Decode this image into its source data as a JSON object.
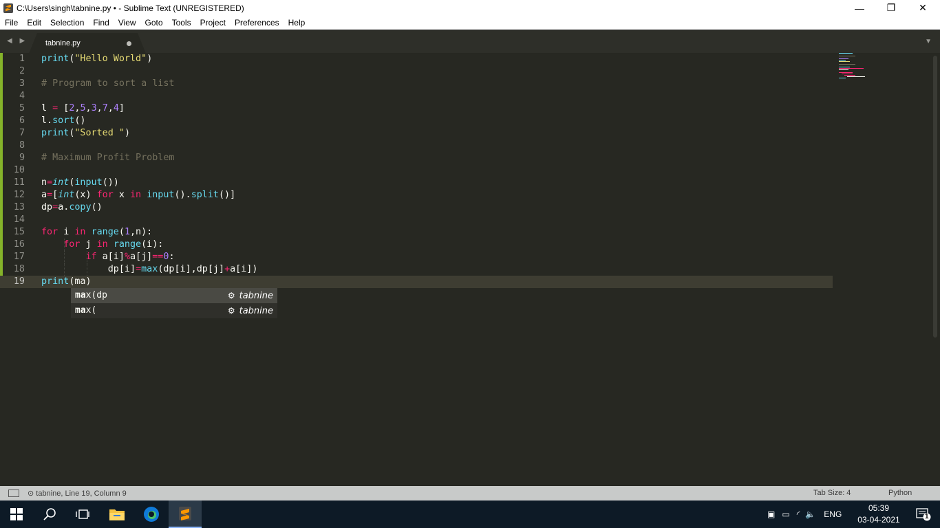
{
  "window": {
    "title": "C:\\Users\\singh\\tabnine.py • - Sublime Text (UNREGISTERED)",
    "minimize": "—",
    "restore": "❐",
    "close": "✕"
  },
  "menu": [
    "File",
    "Edit",
    "Selection",
    "Find",
    "View",
    "Goto",
    "Tools",
    "Project",
    "Preferences",
    "Help"
  ],
  "tab": {
    "label": "tabnine.py",
    "dirty": true,
    "arrows": "◀ ▶",
    "dropdown": "▼"
  },
  "editor": {
    "current_line": 19,
    "lines": [
      [
        [
          "f",
          "print"
        ],
        [
          "",
          "("
        ],
        [
          "s",
          "\"Hello World\""
        ],
        [
          "",
          ")"
        ]
      ],
      [],
      [
        [
          "c",
          "# Program to sort a list"
        ]
      ],
      [],
      [
        [
          "",
          "l "
        ],
        [
          "k",
          "="
        ],
        [
          "",
          " ["
        ],
        [
          "n",
          "2"
        ],
        [
          "",
          ","
        ],
        [
          "n",
          "5"
        ],
        [
          "",
          ","
        ],
        [
          "n",
          "3"
        ],
        [
          "",
          ","
        ],
        [
          "n",
          "7"
        ],
        [
          "",
          ","
        ],
        [
          "n",
          "4"
        ],
        [
          "",
          "]"
        ]
      ],
      [
        [
          "",
          "l."
        ],
        [
          "f",
          "sort"
        ],
        [
          "",
          "()"
        ]
      ],
      [
        [
          "f",
          "print"
        ],
        [
          "",
          "("
        ],
        [
          "s",
          "\"Sorted \""
        ],
        [
          "",
          ")"
        ]
      ],
      [],
      [
        [
          "c",
          "# Maximum Profit Problem"
        ]
      ],
      [],
      [
        [
          "",
          "n"
        ],
        [
          "k",
          "="
        ],
        [
          "t",
          "int"
        ],
        [
          "",
          "("
        ],
        [
          "f",
          "input"
        ],
        [
          "",
          "())"
        ]
      ],
      [
        [
          "",
          "a"
        ],
        [
          "k",
          "="
        ],
        [
          "",
          "["
        ],
        [
          "t",
          "int"
        ],
        [
          "",
          "(x) "
        ],
        [
          "k",
          "for"
        ],
        [
          "",
          " x "
        ],
        [
          "k",
          "in"
        ],
        [
          "",
          " "
        ],
        [
          "f",
          "input"
        ],
        [
          "",
          "()."
        ],
        [
          "f",
          "split"
        ],
        [
          "",
          "()]"
        ]
      ],
      [
        [
          "",
          "dp"
        ],
        [
          "k",
          "="
        ],
        [
          "",
          "a."
        ],
        [
          "f",
          "copy"
        ],
        [
          "",
          "()"
        ]
      ],
      [],
      [
        [
          "k",
          "for"
        ],
        [
          "",
          " i "
        ],
        [
          "k",
          "in"
        ],
        [
          "",
          " "
        ],
        [
          "f",
          "range"
        ],
        [
          "",
          "("
        ],
        [
          "n",
          "1"
        ],
        [
          "",
          ",n):"
        ]
      ],
      [
        [
          "",
          "    "
        ],
        [
          "k",
          "for"
        ],
        [
          "",
          " j "
        ],
        [
          "k",
          "in"
        ],
        [
          "",
          " "
        ],
        [
          "f",
          "range"
        ],
        [
          "",
          "(i):"
        ]
      ],
      [
        [
          "",
          "        "
        ],
        [
          "k",
          "if"
        ],
        [
          "",
          " a[i]"
        ],
        [
          "k",
          "%"
        ],
        [
          "",
          "a[j]"
        ],
        [
          "k",
          "=="
        ],
        [
          "n",
          "0"
        ],
        [
          "",
          ":"
        ]
      ],
      [
        [
          "",
          "            dp[i]"
        ],
        [
          "k",
          "="
        ],
        [
          "f",
          "max"
        ],
        [
          "",
          "(dp[i],dp[j]"
        ],
        [
          "k",
          "+"
        ],
        [
          "",
          "a[i])"
        ]
      ],
      [
        [
          "f",
          "print"
        ],
        [
          "",
          "(ma)"
        ]
      ]
    ]
  },
  "autocomplete": {
    "items": [
      {
        "match": "ma",
        "rest": "x(dp",
        "source": "tabnine",
        "icon": "tabnine-icon"
      },
      {
        "match": "ma",
        "rest": "x(",
        "source": "tabnine",
        "icon": "tabnine-icon"
      }
    ]
  },
  "status": {
    "left": "tabnine, Line 19, Column 9",
    "left_icon": "⊙",
    "tab_size": "Tab Size: 4",
    "syntax": "Python"
  },
  "taskbar": {
    "language": "ENG",
    "time": "05:39",
    "date": "03-04-2021",
    "notifications": "1"
  },
  "colors": {
    "background": "#272822",
    "keyword": "#f92672",
    "string": "#e6db74",
    "number": "#ae81ff",
    "function": "#66d9ef",
    "comment": "#75715e"
  }
}
